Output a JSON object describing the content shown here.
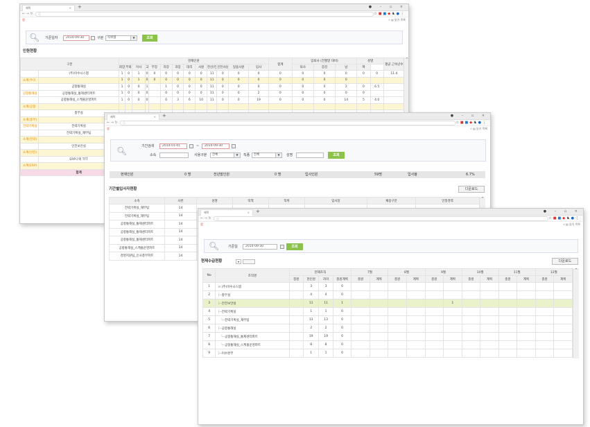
{
  "browser": {
    "tab_title": "제목",
    "url_text": "",
    "bookmark": "앱",
    "reading_list": "읽기 목록"
  },
  "win1": {
    "date_label": "기준일자",
    "date": "2014-09-30",
    "type_label": "구분",
    "type_value": "직위별",
    "search": "조회",
    "section": "인원현황",
    "head": {
      "group": "구분",
      "current": "현재인원",
      "total": "합계",
      "inout": "입퇴사 (전월말 대비)",
      "gender": "성별",
      "avg": "평균 근속년수",
      "sub": [
        "회장",
        "부회장",
        "이사",
        "고",
        "부장",
        "차장",
        "과장",
        "대리",
        "사원",
        "전산/전문직",
        "인턴사원",
        "일용사원",
        "입사",
        "퇴사",
        "증감",
        "남",
        "여"
      ]
    },
    "rows": [
      {
        "cat": "",
        "name": "(주)이수시스템",
        "vals": [
          "1",
          "0",
          "1",
          "0",
          "0",
          "0",
          "0",
          "0",
          "0",
          "11",
          "0",
          "0",
          "0",
          "0",
          "0",
          "0",
          "0",
          "0",
          "0",
          "11.4"
        ],
        "hl": false
      },
      {
        "cat": "소계(주이",
        "name": "",
        "vals": [
          "1",
          "0",
          "1",
          "0",
          "0",
          "0",
          "0",
          "0",
          "0",
          "11",
          "0",
          "0",
          "0",
          "0",
          "0",
          "0",
          "0",
          "",
          "",
          ""
        ],
        "hl": true
      },
      {
        "cat": "",
        "name": "공항통해실",
        "vals": [
          "1",
          "0",
          "0",
          "1",
          "",
          "1",
          "0",
          "0",
          "0",
          "11",
          "0",
          "0",
          "0",
          "0",
          "0",
          "0",
          "2",
          "0",
          "6.5",
          ""
        ],
        "hl": false
      },
      {
        "cat": "공항통해실",
        "name": "공항통해실_통제센터파트",
        "vals": [
          "1",
          "0",
          "0",
          "0",
          "",
          "0",
          "0",
          "0",
          "0",
          "11",
          "0",
          "0",
          "2",
          "0",
          "0",
          "0",
          "0",
          "0",
          "",
          ""
        ],
        "hl": false
      },
      {
        "cat": "",
        "name": "공항통해실_스케줄운영파트",
        "vals": [
          "1",
          "0",
          "0",
          "0",
          "",
          "0",
          "3",
          "6",
          "10",
          "11",
          "0",
          "0",
          "19",
          "0",
          "0",
          "0",
          "14",
          "5",
          "4.0",
          ""
        ],
        "hl": false
      },
      {
        "cat": "소계(공항",
        "name": "",
        "vals": [],
        "hl": true
      },
      {
        "cat": "",
        "name": "총무실",
        "vals": [],
        "hl": false
      },
      {
        "cat": "소계(총무)",
        "name": "",
        "vals": [],
        "hl": true
      },
      {
        "cat": "전략기획실",
        "name": "전략기획실",
        "vals": [],
        "hl": false
      },
      {
        "cat": "",
        "name": "전략기획실_재무팀",
        "vals": [],
        "hl": false
      },
      {
        "cat": "소계(전략)",
        "name": "",
        "vals": [],
        "hl": true
      },
      {
        "cat": "",
        "name": "인전보안실",
        "vals": [],
        "hl": false
      },
      {
        "cat": "소계(안전)",
        "name": "",
        "vals": [],
        "hl": true
      },
      {
        "cat": "",
        "name": "ERP구축 TFT",
        "vals": [],
        "hl": false
      },
      {
        "cat": "소계(ERP)",
        "name": "",
        "vals": [],
        "hl": true
      },
      {
        "cat": "",
        "name": "합계",
        "vals": [],
        "hl": false,
        "pink": true
      }
    ]
  },
  "win2": {
    "period_label": "기간검색",
    "date_from": "2014-01-01",
    "tilde": "~",
    "date_to": "2014-09-30",
    "org_label": "소속",
    "usage_label": "사용구분",
    "usage_value": "전체",
    "job_label": "직종",
    "job_value": "전체",
    "name_label": "성명",
    "search": "조회",
    "stats": [
      {
        "label": "현재인원",
        "value": "0 명"
      },
      {
        "label": "전년말인원",
        "value": "0 명"
      },
      {
        "label": "입사인원",
        "value": "59명"
      },
      {
        "label": "입사율",
        "value": "6.7%"
      }
    ],
    "section": "기간별입사자현황",
    "download": "다운로드",
    "cols": [
      "소속",
      "사번",
      "성명",
      "직책",
      "직위",
      "입사일",
      "채용구분",
      "인정경력"
    ],
    "rows": [
      {
        "org": "전략기획실_재무팀",
        "id": "14"
      },
      {
        "org": "전략기획실_재무팀",
        "id": "14"
      },
      {
        "org": "공항통해실_통제센터파트",
        "id": "14"
      },
      {
        "org": "공항통해실_통제센터파트",
        "id": "14"
      },
      {
        "org": "공항통해실_통제센터파트",
        "id": "14"
      },
      {
        "org": "공항통해실_스케줄운영파트",
        "id": "14"
      },
      {
        "org": "경영지원팀_인사총무파트",
        "id": "14"
      }
    ]
  },
  "win3": {
    "date_label": "기준일",
    "date": "2014-09-30",
    "search": "조회",
    "section": "현재수급현황",
    "download": "다운로드",
    "head": {
      "no": "No",
      "org": "조직명",
      "cur": "현재조직",
      "sub": [
        "정원",
        "현인원",
        "차이",
        "충원계획"
      ],
      "months": [
        "7월",
        "8월",
        "9월",
        "10월",
        "11월",
        "12월"
      ],
      "mcols": [
        "충원",
        "계획"
      ]
    },
    "rows": [
      {
        "no": "1",
        "org": "(주)이수시스템",
        "indent": 0,
        "cap": "",
        "cur": "3",
        "diff": "3",
        "plan": "0"
      },
      {
        "no": "2",
        "org": "총무실",
        "indent": 1,
        "cap": "",
        "cur": "4",
        "diff": "4",
        "plan": "0"
      },
      {
        "no": "3",
        "org": "안전보안실",
        "indent": 1,
        "cap": "",
        "cur": "11",
        "diff": "11",
        "plan": "1",
        "sel": true,
        "m9": "1"
      },
      {
        "no": "4",
        "org": "전략기획실",
        "indent": 1,
        "cap": "",
        "cur": "1",
        "diff": "1",
        "plan": "0"
      },
      {
        "no": "5",
        "org": "전략기획실_재무팀",
        "indent": 2,
        "cap": "",
        "cur": "13",
        "diff": "13",
        "plan": "0"
      },
      {
        "no": "6",
        "org": "공항통해실",
        "indent": 1,
        "cap": "",
        "cur": "2",
        "diff": "2",
        "plan": "0"
      },
      {
        "no": "7",
        "org": "공항통해실_통제센터파트",
        "indent": 2,
        "cap": "",
        "cur": "19",
        "diff": "19",
        "plan": "0"
      },
      {
        "no": "8",
        "org": "공항통해실_스케줄운영파트",
        "indent": 2,
        "cap": "",
        "cur": "8",
        "diff": "8",
        "plan": "0"
      },
      {
        "no": "9",
        "org": "이수본부",
        "indent": 1,
        "cap": "",
        "cur": "1",
        "diff": "1",
        "plan": "0"
      }
    ]
  }
}
